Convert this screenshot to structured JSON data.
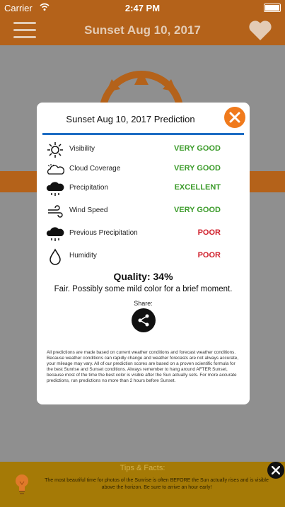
{
  "status_bar": {
    "carrier": "Carrier",
    "time": "2:47 PM"
  },
  "navbar": {
    "title": "Sunset Aug 10, 2017"
  },
  "dialog": {
    "title": "Sunset Aug 10, 2017 Prediction",
    "rows": [
      {
        "icon": "sun-icon",
        "label": "Visibility",
        "value": "VERY GOOD",
        "status": "good"
      },
      {
        "icon": "cloud-icon",
        "label": "Cloud Coverage",
        "value": "VERY GOOD",
        "status": "good"
      },
      {
        "icon": "rain-cloud-icon",
        "label": "Precipitation",
        "value": "EXCELLENT",
        "status": "good"
      },
      {
        "icon": "wind-icon",
        "label": "Wind Speed",
        "value": "VERY GOOD",
        "status": "good"
      },
      {
        "icon": "rain-cloud-icon",
        "label": "Previous Precipitation",
        "value": "POOR",
        "status": "poor"
      },
      {
        "icon": "drop-icon",
        "label": "Humidity",
        "value": "POOR",
        "status": "poor"
      }
    ],
    "quality": "Quality: 34%",
    "description": "Fair. Possibly some mild color for a brief moment.",
    "share_label": "Share:",
    "disclaimer": "All predictions are made based on current weather conditions and forecast weather conditions. Because weather conditions can rapidly change and weather forecasts are not always accurate, your mileage may vary. All of our prediction scores are based on a proven scientific formula for the best Sunrise and Sunset conditions. Always remember to hang around AFTER Sunset, because most of the time the best color is visible after the Sun actually sets. For more accurate predictions, run predictions no more than 2 hours before Sunset."
  },
  "tips": {
    "title": "Tips & Facts:",
    "text": "The most beautiful time for photos of the Sunrise is often BEFORE the Sun actually rises and is visible above the horizon. Be sure to arrive an hour early!"
  },
  "colors": {
    "brand": "#b4621a",
    "accent": "#f07a1c",
    "good": "#3b9b2a",
    "poor": "#d0202c",
    "rule": "#1e6dc3"
  }
}
